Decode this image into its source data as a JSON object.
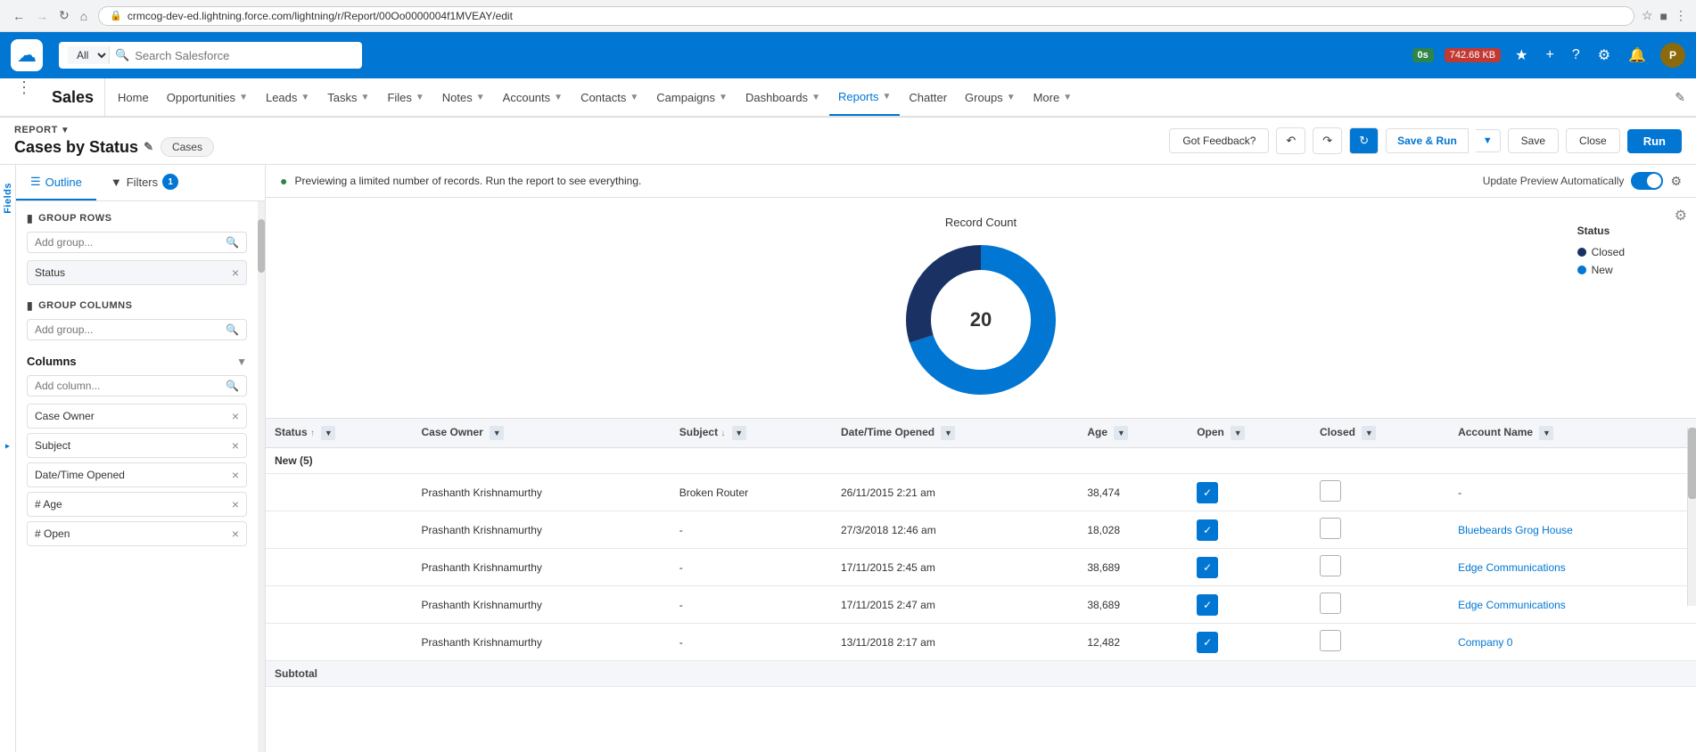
{
  "browser": {
    "url": "crmcog-dev-ed.lightning.force.com/lightning/r/Report/00Oo0000004f1MVEAY/edit",
    "back_disabled": false,
    "forward_disabled": false
  },
  "sf_header": {
    "search_placeholder": "Search Salesforce",
    "search_filter": "All",
    "timer_badge": "0s",
    "storage_badge": "742.68 KB"
  },
  "nav": {
    "app_name": "Sales",
    "items": [
      {
        "label": "Home",
        "has_dropdown": false
      },
      {
        "label": "Opportunities",
        "has_dropdown": true
      },
      {
        "label": "Leads",
        "has_dropdown": true
      },
      {
        "label": "Tasks",
        "has_dropdown": true
      },
      {
        "label": "Files",
        "has_dropdown": true
      },
      {
        "label": "Notes",
        "has_dropdown": true
      },
      {
        "label": "Accounts",
        "has_dropdown": true
      },
      {
        "label": "Contacts",
        "has_dropdown": true
      },
      {
        "label": "Campaigns",
        "has_dropdown": true
      },
      {
        "label": "Dashboards",
        "has_dropdown": true
      },
      {
        "label": "Reports",
        "has_dropdown": true,
        "active": true
      },
      {
        "label": "Chatter",
        "has_dropdown": false
      },
      {
        "label": "Groups",
        "has_dropdown": true
      },
      {
        "label": "More",
        "has_dropdown": true
      }
    ]
  },
  "report_header": {
    "report_label": "REPORT",
    "report_title": "Cases by Status",
    "object_pill": "Cases",
    "feedback_btn": "Got Feedback?",
    "save_run_btn": "Save & Run",
    "save_btn": "Save",
    "close_btn": "Close",
    "run_btn": "Run"
  },
  "left_panel": {
    "tabs": [
      {
        "label": "Outline",
        "active": true,
        "icon": "☰"
      },
      {
        "label": "Filters",
        "active": false,
        "icon": "▼",
        "badge": "1"
      }
    ],
    "group_rows": {
      "section_label": "GROUP ROWS",
      "add_placeholder": "Add group...",
      "chips": [
        {
          "label": "Status",
          "removable": true
        }
      ]
    },
    "group_columns": {
      "section_label": "GROUP COLUMNS",
      "add_placeholder": "Add group..."
    },
    "columns": {
      "title": "Columns",
      "add_placeholder": "Add column...",
      "items": [
        {
          "label": "Case Owner"
        },
        {
          "label": "Subject"
        },
        {
          "label": "Date/Time Opened"
        },
        {
          "label": "# Age"
        },
        {
          "label": "# Open"
        }
      ]
    }
  },
  "preview_banner": {
    "message": "Previewing a limited number of records. Run the report to see everything.",
    "update_label": "Update Preview Automatically"
  },
  "chart": {
    "title": "Record Count",
    "center_value": "20",
    "legend": [
      {
        "label": "Closed",
        "color": "#1a3263"
      },
      {
        "label": "New",
        "color": "#0176d3"
      }
    ],
    "segments": [
      {
        "label": "Closed",
        "value": 30,
        "color": "#1a3263"
      },
      {
        "label": "New",
        "value": 70,
        "color": "#0176d3"
      }
    ]
  },
  "table": {
    "columns": [
      {
        "label": "Status",
        "sortable": true,
        "filterable": true
      },
      {
        "label": "Case Owner",
        "sortable": false,
        "filterable": true
      },
      {
        "label": "Subject",
        "sortable": true,
        "filterable": true
      },
      {
        "label": "Date/Time Opened",
        "sortable": false,
        "filterable": true
      },
      {
        "label": "Age",
        "sortable": false,
        "filterable": true
      },
      {
        "label": "Open",
        "sortable": false,
        "filterable": true
      },
      {
        "label": "Closed",
        "sortable": false,
        "filterable": true
      },
      {
        "label": "Account Name",
        "sortable": false,
        "filterable": true
      }
    ],
    "rows": [
      {
        "type": "group_header",
        "status": "New (5)",
        "case_owner": "",
        "subject": "",
        "datetime_opened": "",
        "age": "",
        "open": "",
        "closed": "",
        "account_name": ""
      },
      {
        "type": "data",
        "status": "",
        "case_owner": "Prashanth Krishnamurthy",
        "subject": "Broken Router",
        "datetime_opened": "26/11/2015 2:21 am",
        "age": "38,474",
        "open": "checked",
        "closed": "unchecked",
        "account_name": "-"
      },
      {
        "type": "data",
        "status": "",
        "case_owner": "Prashanth Krishnamurthy",
        "subject": "-",
        "datetime_opened": "27/3/2018 12:46 am",
        "age": "18,028",
        "open": "checked",
        "closed": "unchecked",
        "account_name": "Bluebeards Grog House"
      },
      {
        "type": "data",
        "status": "",
        "case_owner": "Prashanth Krishnamurthy",
        "subject": "-",
        "datetime_opened": "17/11/2015 2:45 am",
        "age": "38,689",
        "open": "checked",
        "closed": "unchecked",
        "account_name": "Edge Communications"
      },
      {
        "type": "data",
        "status": "",
        "case_owner": "Prashanth Krishnamurthy",
        "subject": "-",
        "datetime_opened": "17/11/2015 2:47 am",
        "age": "38,689",
        "open": "checked",
        "closed": "unchecked",
        "account_name": "Edge Communications"
      },
      {
        "type": "data",
        "status": "",
        "case_owner": "Prashanth Krishnamurthy",
        "subject": "-",
        "datetime_opened": "13/11/2018 2:17 am",
        "age": "12,482",
        "open": "checked",
        "closed": "unchecked",
        "account_name": "Company 0"
      },
      {
        "type": "subtotal",
        "status": "Subtotal",
        "case_owner": "",
        "subject": "",
        "datetime_opened": "",
        "age": "",
        "open": "",
        "closed": "",
        "account_name": ""
      }
    ]
  },
  "fields_sidebar": {
    "label": "Fields"
  }
}
